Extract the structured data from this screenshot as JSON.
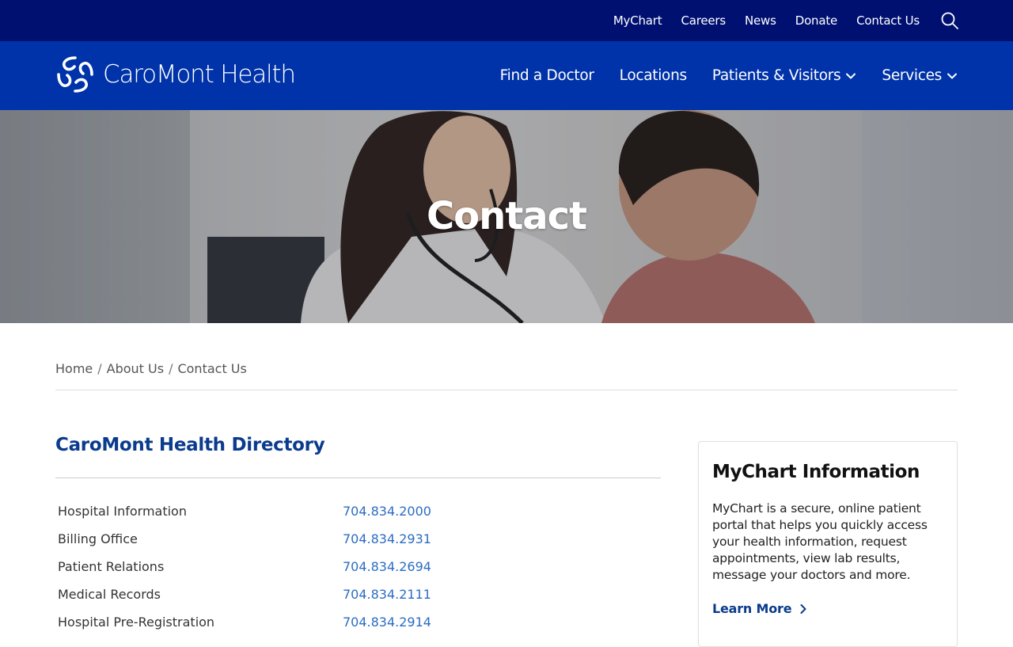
{
  "utility_nav": {
    "items": [
      {
        "label": "MyChart"
      },
      {
        "label": "Careers"
      },
      {
        "label": "News"
      },
      {
        "label": "Donate"
      },
      {
        "label": "Contact Us"
      }
    ],
    "search_icon": "search-icon"
  },
  "header": {
    "logo_text": "CaroMont Health",
    "nav": [
      {
        "label": "Find a Doctor",
        "has_dropdown": false
      },
      {
        "label": "Locations",
        "has_dropdown": false
      },
      {
        "label": "Patients & Visitors",
        "has_dropdown": true
      },
      {
        "label": "Services",
        "has_dropdown": true
      }
    ]
  },
  "hero": {
    "title": "Contact"
  },
  "breadcrumb": [
    {
      "label": "Home"
    },
    {
      "label": "About Us"
    },
    {
      "label": "Contact Us"
    }
  ],
  "directory": {
    "title": "CaroMont Health Directory",
    "rows": [
      {
        "label": "Hospital Information",
        "phone": "704.834.2000"
      },
      {
        "label": "Billing Office",
        "phone": "704.834.2931"
      },
      {
        "label": "Patient Relations",
        "phone": "704.834.2694"
      },
      {
        "label": "Medical Records",
        "phone": "704.834.2111"
      },
      {
        "label": "Hospital Pre-Registration",
        "phone": "704.834.2914"
      }
    ]
  },
  "mychart_card": {
    "title": "MyChart Information",
    "body": "MyChart is a secure, online patient portal that helps you quickly access your health information, request appointments, view lab results, message your doctors and more.",
    "link_label": "Learn More"
  },
  "colors": {
    "utility_bar": "#001070",
    "header": "#0033a9",
    "heading_blue": "#0a3b8c",
    "link_blue": "#2b6cc4"
  }
}
